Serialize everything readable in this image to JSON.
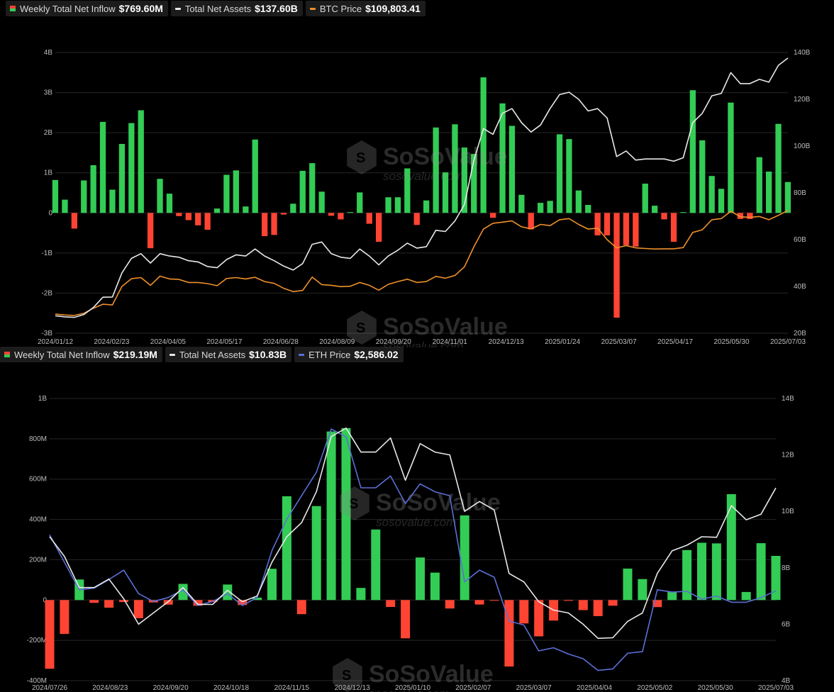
{
  "colors": {
    "green": "#33cc55",
    "red": "#ff4433",
    "white": "#e8e8e8",
    "orange": "#f0902a",
    "blue": "#5b6fd6"
  },
  "watermark": {
    "brand": "SoSoValue",
    "domain": "sosovalue.com"
  },
  "legend_btc": {
    "inflow_label": "Weekly Total Net Inflow",
    "inflow_value": "$769.60M",
    "assets_label": "Total Net Assets",
    "assets_value": "$137.60B",
    "price_label": "BTC Price",
    "price_value": "$109,803.41"
  },
  "legend_eth": {
    "inflow_label": "Weekly Total Net Inflow",
    "inflow_value": "$219.19M",
    "assets_label": "Total Net Assets",
    "assets_value": "$10.83B",
    "price_label": "ETH Price",
    "price_value": "$2,586.02"
  },
  "chart_data": [
    {
      "type": "bar",
      "x_tick_labels": [
        "2024/01/12",
        "2024/02/23",
        "2024/04/05",
        "2024/05/17",
        "2024/06/28",
        "2024/08/09",
        "2024/09/20",
        "2024/11/01",
        "2024/12/13",
        "2025/01/24",
        "2025/03/07",
        "2025/04/17",
        "2025/05/30",
        "2025/07/03"
      ],
      "y_left_ticks": [
        "4B",
        "3B",
        "2B",
        "1B",
        "0",
        "-1B",
        "-2B",
        "-3B"
      ],
      "y_right_ticks": [
        "140B",
        "120B",
        "100B",
        "80B",
        "60B",
        "40B",
        "20B"
      ],
      "ylim_left": [
        -3,
        4
      ],
      "ylim_right": [
        20,
        140
      ],
      "grid": true,
      "series": [
        {
          "name": "Weekly Total Net Inflow",
          "unit": "B",
          "type": "bar",
          "values": [
            0.82,
            0.33,
            -0.39,
            0.81,
            1.19,
            2.27,
            0.58,
            1.72,
            2.24,
            2.56,
            -0.88,
            0.85,
            0.48,
            -0.08,
            -0.18,
            -0.31,
            -0.42,
            0.11,
            0.95,
            1.06,
            0.16,
            1.83,
            -0.58,
            -0.55,
            -0.04,
            0.23,
            1.05,
            1.24,
            0.53,
            -0.07,
            -0.16,
            0.02,
            0.51,
            -0.27,
            -0.72,
            0.39,
            0.39,
            1.11,
            -0.3,
            0.31,
            2.13,
            1.01,
            2.21,
            1.63,
            1.47,
            3.38,
            -0.12,
            2.73,
            2.17,
            0.45,
            -0.41,
            0.25,
            0.3,
            1.96,
            1.84,
            0.56,
            0.2,
            -0.56,
            -0.56,
            -2.61,
            -0.8,
            -0.84,
            0.73,
            0.18,
            -0.16,
            -0.72,
            0.02,
            3.06,
            1.81,
            0.92,
            0.6,
            2.75,
            -0.15,
            -0.15,
            1.39,
            1.03,
            2.22,
            0.77
          ]
        },
        {
          "name": "Total Net Assets",
          "unit": "B",
          "type": "line",
          "values": [
            27.5,
            27,
            26.8,
            28,
            31,
            35.4,
            35.5,
            45.8,
            52,
            54,
            50,
            54,
            53,
            52.5,
            51,
            50.5,
            48.5,
            48,
            51.5,
            53.5,
            53,
            56,
            53,
            51,
            48.7,
            47,
            49.8,
            58,
            59,
            54,
            52.5,
            52,
            56,
            53,
            49.2,
            53,
            55.5,
            58.5,
            56.4,
            57,
            64,
            63.5,
            68,
            75,
            94,
            107.5,
            105,
            114,
            116,
            110,
            106,
            109,
            116,
            122,
            123,
            120,
            115,
            116,
            112,
            95.5,
            97.9,
            94,
            94.5,
            94.5,
            94.5,
            93.5,
            95,
            110,
            114,
            121.5,
            122.5,
            131.4,
            126.7,
            126.7,
            128.5,
            127.3,
            134.5,
            137.6
          ]
        },
        {
          "name": "BTC Price",
          "unit": "K",
          "type": "line",
          "values": [
            28.2,
            27.8,
            27.6,
            28.5,
            30.7,
            32.4,
            32.1,
            40,
            43.3,
            43.8,
            40.5,
            44.4,
            43.2,
            43,
            41.7,
            41.7,
            41.2,
            40.3,
            43.4,
            43.8,
            43.2,
            43.9,
            42.1,
            41.3,
            39.2,
            37.8,
            38.3,
            44,
            40.8,
            40.5,
            39.9,
            40.1,
            41.7,
            40.5,
            38.4,
            40.9,
            42.1,
            43.1,
            41.7,
            42.1,
            44.3,
            43.5,
            44.7,
            48.4,
            57,
            64.5,
            67,
            67.5,
            68,
            65.5,
            64.6,
            66.5,
            66,
            68.5,
            69,
            66.5,
            64.5,
            64.9,
            60,
            56.5,
            57.5,
            56.5,
            56.2,
            56,
            56.1,
            56.1,
            56.6,
            63.1,
            64.2,
            68.5,
            69,
            72.1,
            69.8,
            69.5,
            69.9,
            68.5,
            70.4,
            72.5
          ]
        }
      ]
    },
    {
      "type": "bar",
      "x_tick_labels": [
        "2024/07/26",
        "2024/08/23",
        "2024/09/20",
        "2024/10/18",
        "2024/11/15",
        "2024/12/13",
        "2025/01/10",
        "2025/02/07",
        "2025/03/07",
        "2025/04/04",
        "2025/05/02",
        "2025/05/30",
        "2025/07/03"
      ],
      "y_left_ticks": [
        "1B",
        "800M",
        "600M",
        "400M",
        "200M",
        "0",
        "-200M",
        "-400M"
      ],
      "y_right_ticks": [
        "14B",
        "12B",
        "10B",
        "8B",
        "6B",
        "4B"
      ],
      "ylim_left": [
        -400,
        1000
      ],
      "ylim_right": [
        4,
        14
      ],
      "grid": true,
      "series": [
        {
          "name": "Weekly Total Net Inflow",
          "unit": "M",
          "type": "bar",
          "values": [
            -341,
            -168,
            102,
            -14,
            -38,
            -10,
            -90,
            -12,
            -23,
            80,
            -28,
            -10,
            77,
            -25,
            12,
            155,
            515,
            -70,
            466,
            836,
            853,
            60,
            350,
            -34,
            -190,
            211,
            136,
            -42,
            420,
            -22,
            -1,
            -330,
            -116,
            -180,
            -102,
            -4,
            -50,
            -80,
            -28,
            156,
            104,
            -35,
            40,
            248,
            284,
            281,
            525,
            40,
            282,
            219
          ]
        },
        {
          "name": "Total Net Assets",
          "unit": "B",
          "type": "line",
          "values": [
            9.1,
            8.4,
            7.3,
            7.3,
            7.6,
            6.9,
            6,
            6.4,
            6.8,
            7.3,
            6.7,
            6.7,
            7.2,
            6.8,
            7,
            8.2,
            9.1,
            9.6,
            10.7,
            12.65,
            12.95,
            12.1,
            12.1,
            12.6,
            11.1,
            12.4,
            12.1,
            12,
            10,
            10.35,
            10.05,
            7.8,
            7.5,
            6.8,
            6.5,
            6.4,
            6,
            5.5,
            5.52,
            6.1,
            6.4,
            7.8,
            8.6,
            8.8,
            9.1,
            9.08,
            10.2,
            9.7,
            9.9,
            10.83
          ]
        },
        {
          "name": "ETH Price",
          "unit": "",
          "type": "line",
          "values": [
            3300,
            2950,
            2600,
            2620,
            2730,
            2850,
            2550,
            2450,
            2500,
            2600,
            2400,
            2450,
            2550,
            2400,
            2500,
            3100,
            3500,
            3800,
            4100,
            4650,
            4550,
            3900,
            3900,
            4050,
            3700,
            3950,
            3850,
            3800,
            2700,
            2850,
            2760,
            2200,
            2150,
            1820,
            1860,
            1780,
            1720,
            1570,
            1590,
            1790,
            1810,
            2600,
            2570,
            2580,
            2480,
            2520,
            2440,
            2440,
            2500,
            2586
          ]
        }
      ]
    }
  ]
}
